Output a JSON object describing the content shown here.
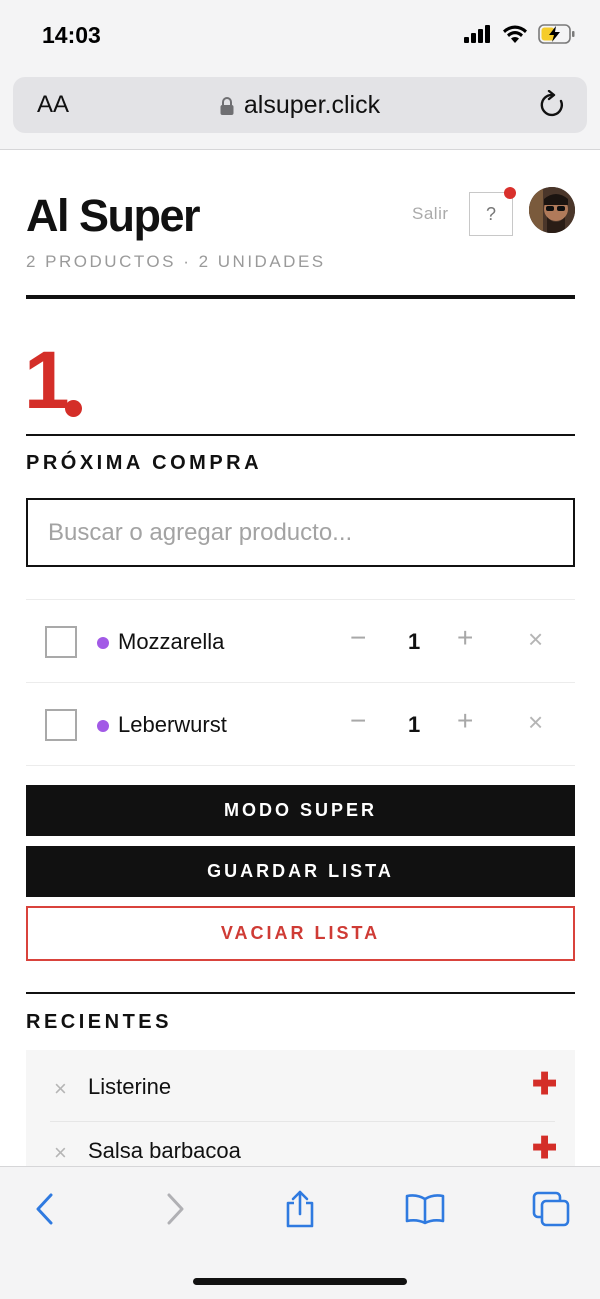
{
  "status_bar": {
    "time": "14:03"
  },
  "browser": {
    "text_size_label": "AA",
    "url": "alsuper.click"
  },
  "header": {
    "title": "Al Super",
    "subtitle": "2 PRODUCTOS · 2 UNIDADES",
    "logout_label": "Salir",
    "help_label": "?"
  },
  "step": {
    "number": "1"
  },
  "next_purchase": {
    "title": "PRÓXIMA COMPRA",
    "search_placeholder": "Buscar o agregar producto...",
    "items": [
      {
        "name": "Mozzarella",
        "quantity": "1",
        "minus": "−",
        "plus": "+",
        "remove": "×",
        "dot_color": "#a25ae6"
      },
      {
        "name": "Leberwurst",
        "quantity": "1",
        "minus": "−",
        "plus": "+",
        "remove": "×",
        "dot_color": "#a25ae6"
      }
    ]
  },
  "actions": {
    "super_mode": "MODO SUPER",
    "save_list": "GUARDAR LISTA",
    "clear_list": "VACIAR LISTA"
  },
  "recent": {
    "title": "RECIENTES",
    "items": [
      {
        "name": "Listerine",
        "remove": "×",
        "add": "✚"
      },
      {
        "name": "Salsa barbacoa",
        "remove": "×",
        "add": "✚"
      }
    ]
  },
  "colors": {
    "accent_red": "#d42e28",
    "ios_blue": "#2f7ae0",
    "item_dot": "#a25ae6"
  },
  "icons": {
    "toolbar": [
      "back-icon",
      "forward-icon",
      "share-icon",
      "bookmarks-icon",
      "tabs-icon"
    ]
  }
}
